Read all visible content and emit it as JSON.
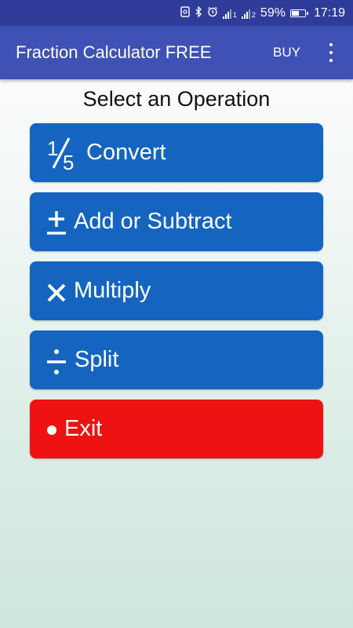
{
  "status_bar": {
    "battery_text": "59%",
    "battery_level": 0.59,
    "time": "17:19",
    "signal_label_1": "1",
    "signal_label_2": "2",
    "icons": [
      "nfc-icon",
      "bluetooth-icon",
      "alarm-icon",
      "signal-icon",
      "signal-icon",
      "battery-icon"
    ]
  },
  "app_bar": {
    "title": "Fraction Calculator FREE",
    "buy_label": "BUY",
    "color": "#3f51b5"
  },
  "main": {
    "heading": "Select an Operation",
    "buttons": [
      {
        "label": "Convert",
        "icon": "one-fifth-icon",
        "color": "#1565c0"
      },
      {
        "label": "Add or Subtract",
        "icon": "plus-minus-icon",
        "color": "#1565c0"
      },
      {
        "label": "Multiply",
        "icon": "multiply-icon",
        "color": "#1565c0"
      },
      {
        "label": "Split",
        "icon": "divide-icon",
        "color": "#1565c0"
      },
      {
        "label": "Exit",
        "icon": "bullet-icon",
        "color": "#ee1212"
      }
    ]
  }
}
